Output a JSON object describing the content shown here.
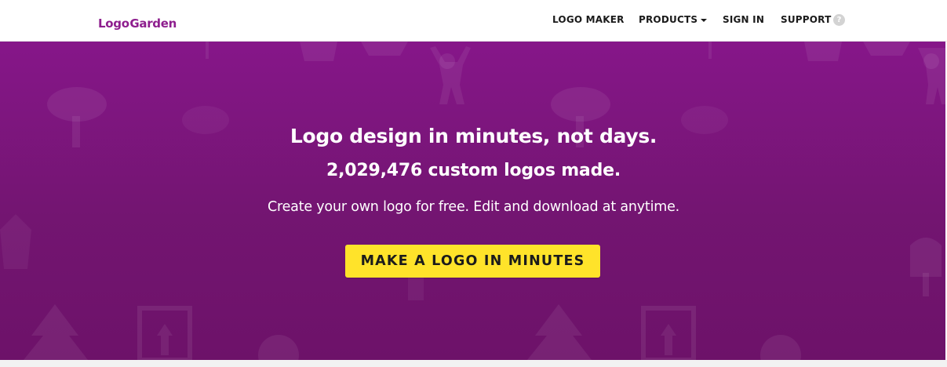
{
  "brand": {
    "name_part1": "Logo",
    "name_part2": "Garden",
    "color": "#8e1e8e"
  },
  "nav": {
    "logo_maker": "LOGO MAKER",
    "products": "PRODUCTS",
    "sign_in": "SIGN IN",
    "support": "SUPPORT",
    "help_glyph": "?"
  },
  "hero": {
    "headline": "Logo design in minutes, not days.",
    "counter": "2,029,476 custom logos made.",
    "tagline": "Create your own logo for free. Edit and download at anytime.",
    "cta_label": "MAKE A LOGO IN MINUTES",
    "background_color": "#7b157b",
    "cta_color": "#ffe32a"
  },
  "icons": {
    "logo_mark": "tree-sprout-icon",
    "products_caret": "caret-down-icon",
    "help": "question-circle-icon",
    "hero_pattern": [
      "tree-icon",
      "person-icon",
      "pine-tree-icon",
      "frame-icon",
      "cloud-tree-icon"
    ]
  }
}
